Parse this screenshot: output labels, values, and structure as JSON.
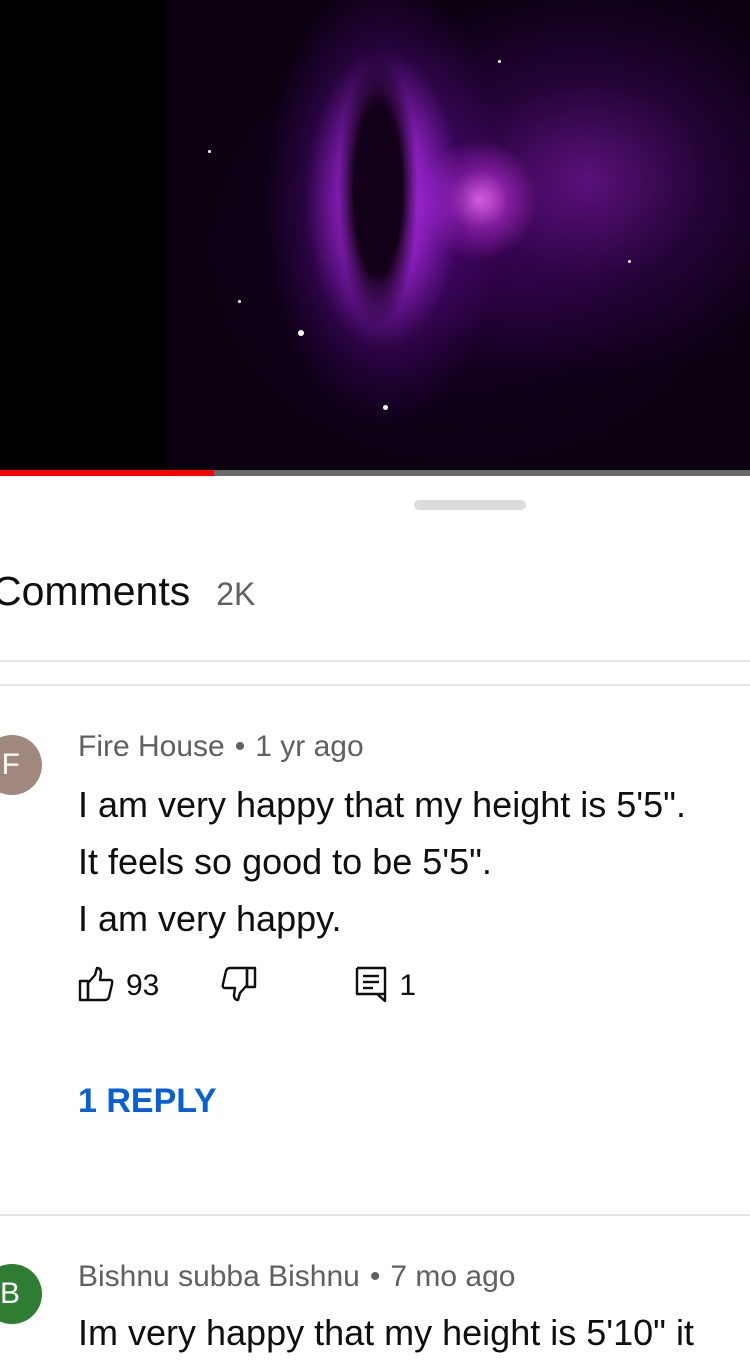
{
  "video": {
    "progress_fraction": 0.285
  },
  "comments_panel": {
    "title": "Comments",
    "count": "2K"
  },
  "comments": [
    {
      "avatar_initial": "F",
      "avatar_color": "#a1887f",
      "author": "Fire House",
      "separator": "•",
      "time": "1 yr ago",
      "lines": [
        "I am very happy that my height is 5'5\".",
        "It feels so good to be 5'5\".",
        "I am very happy."
      ],
      "likes": "93",
      "replies_count": "1",
      "reply_link": "1 REPLY"
    },
    {
      "avatar_initial": "B",
      "avatar_color": "#2e7d32",
      "author": "Bishnu subba Bishnu",
      "separator": "•",
      "time": "7 mo ago",
      "lines": [
        "Im very happy that my height is 5'10\" it"
      ]
    }
  ],
  "icons": {
    "like": "thumbs-up-icon",
    "dislike": "thumbs-down-icon",
    "reply": "comment-icon"
  },
  "colors": {
    "progress_played": "#ff0000",
    "link_blue": "#065fd4"
  }
}
